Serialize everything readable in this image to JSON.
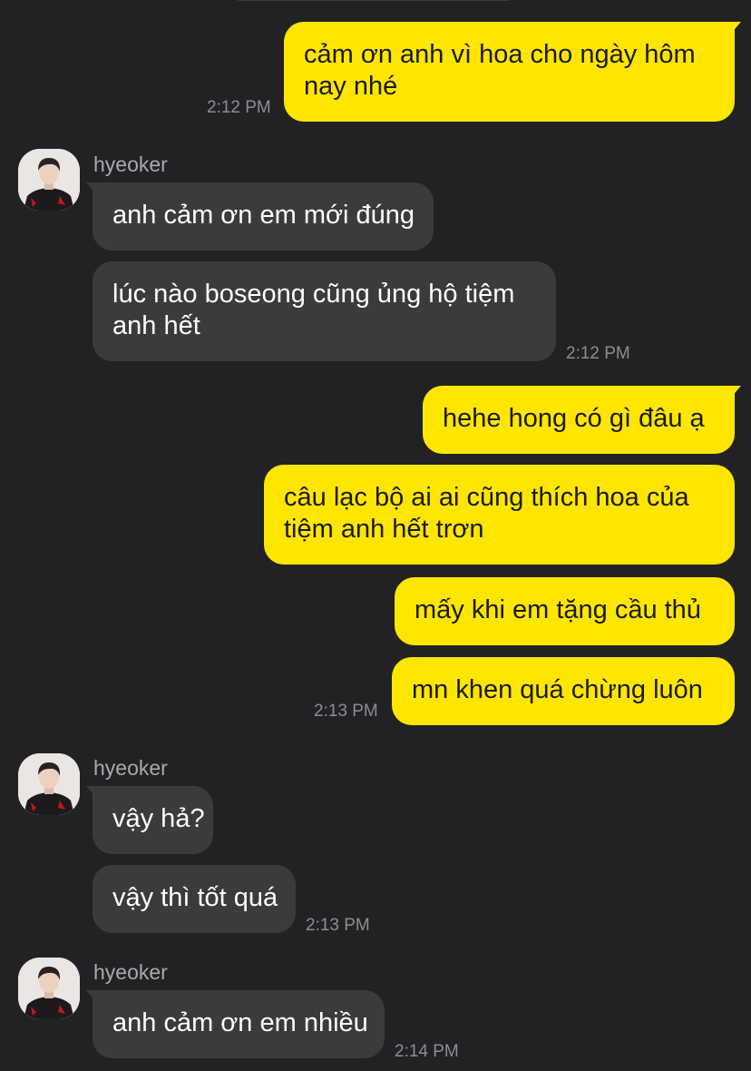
{
  "chat": {
    "contact_name": "hyeoker",
    "messages": [
      {
        "direction": "out",
        "text_lines": [
          "cảm ơn anh vì hoa cho ngày hôm",
          "nay nhé"
        ],
        "time": "2:12 PM"
      },
      {
        "direction": "in",
        "text_lines": [
          "anh cảm ơn em mới đúng"
        ],
        "time": ""
      },
      {
        "direction": "in",
        "text_lines": [
          "lúc nào boseong cũng ủng hộ tiệm",
          "anh hết"
        ],
        "time": "2:12 PM"
      },
      {
        "direction": "out",
        "text_lines": [
          "hehe hong có gì đâu ạ"
        ],
        "time": ""
      },
      {
        "direction": "out",
        "text_lines": [
          "câu lạc bộ ai ai cũng thích hoa của",
          "tiệm anh hết trơn"
        ],
        "time": ""
      },
      {
        "direction": "out",
        "text_lines": [
          "mấy khi em tặng cầu thủ"
        ],
        "time": ""
      },
      {
        "direction": "out",
        "text_lines": [
          "mn khen quá chừng luôn"
        ],
        "time": "2:13 PM"
      },
      {
        "direction": "in",
        "text_lines": [
          "vậy hả?"
        ],
        "time": ""
      },
      {
        "direction": "in",
        "text_lines": [
          "vậy thì tốt quá"
        ],
        "time": "2:13 PM"
      },
      {
        "direction": "in",
        "text_lines": [
          "anh cảm ơn em nhiều"
        ],
        "time": "2:14 PM"
      }
    ]
  },
  "colors": {
    "background": "#222224",
    "outgoing_bubble": "#ffe600",
    "incoming_bubble": "#3b3b3e",
    "timestamp": "#8d8d92"
  },
  "icons": {
    "avatar": "profile-photo-avatar"
  }
}
